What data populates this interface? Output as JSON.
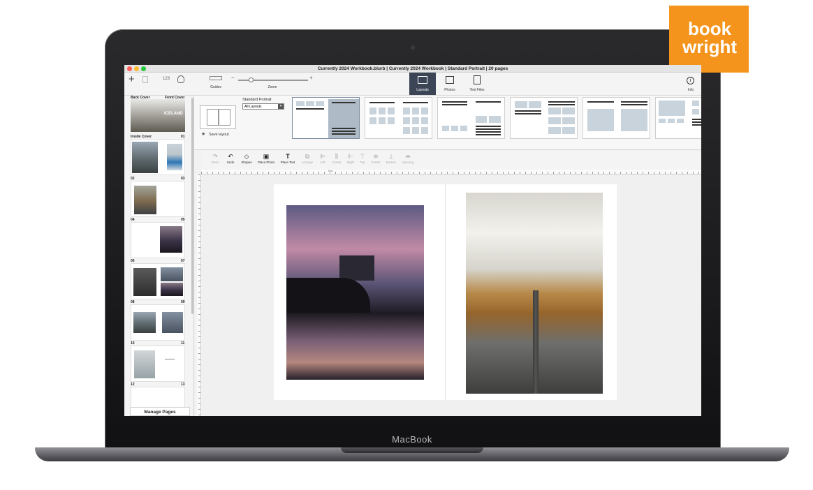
{
  "window": {
    "title": "Currently 2024 Workbook.blurb | Currently 2024 Workbook | Standard Portrait | 20 pages"
  },
  "brand": {
    "logo_line1": "book",
    "logo_line2": "wright",
    "device": "MacBook",
    "accent": "#f5941d"
  },
  "toolbar": {
    "counter": "123",
    "guides_label": "Guides",
    "zoom_label": "Zoom",
    "zoom_minus": "−",
    "zoom_plus": "+",
    "tabs": [
      {
        "label": "Layouts",
        "active": true
      },
      {
        "label": "Photos",
        "active": false
      },
      {
        "label": "Text Files",
        "active": false
      }
    ],
    "info_label": "Info"
  },
  "layouts_panel": {
    "category": "Standard Portrait",
    "filter": "All Layouts",
    "save_layout": "Save layout"
  },
  "edit_tools": [
    {
      "label": "Redo",
      "enabled": false
    },
    {
      "label": "Undo",
      "enabled": true
    },
    {
      "label": "Shapes",
      "enabled": true
    },
    {
      "label": "Place Photo",
      "enabled": true
    },
    {
      "label": "Place Text",
      "enabled": true
    },
    {
      "label": "Arrange",
      "enabled": false
    },
    {
      "label": "Left",
      "enabled": false
    },
    {
      "label": "Center",
      "enabled": false
    },
    {
      "label": "Right",
      "enabled": false
    },
    {
      "label": "Top",
      "enabled": false
    },
    {
      "label": "Center",
      "enabled": false
    },
    {
      "label": "Bottom",
      "enabled": false
    },
    {
      "label": "Spacing",
      "enabled": false
    }
  ],
  "ruler_origin": "0 in",
  "sidebar": {
    "back_cover": "Back Cover",
    "front_cover": "Front Cover",
    "cover_title": "ICELAND",
    "inside_cover": "Inside Cover",
    "page_labels": [
      "01",
      "02",
      "03",
      "04",
      "05",
      "06",
      "07",
      "08",
      "09",
      "10",
      "11",
      "12",
      "13"
    ],
    "manage_pages": "Manage Pages"
  }
}
